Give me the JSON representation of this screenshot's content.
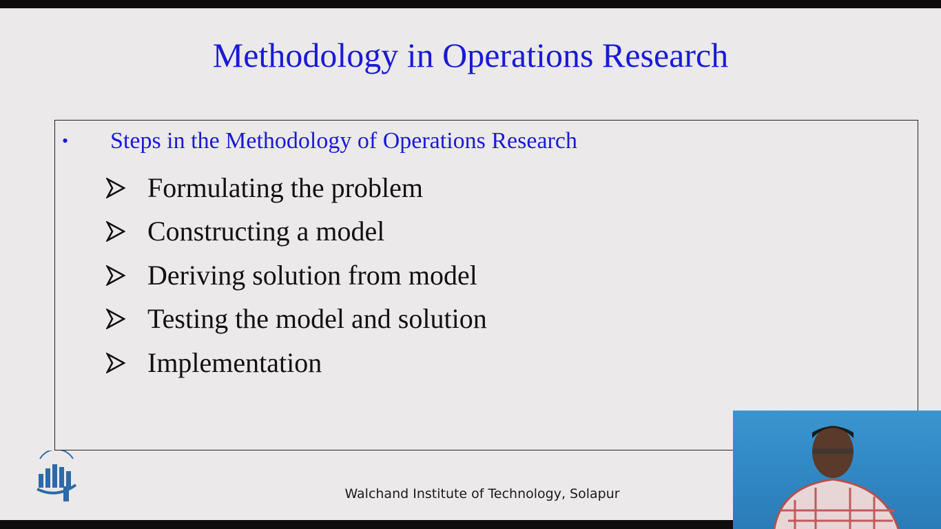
{
  "slide": {
    "title": "Methodology in Operations Research",
    "bullet": "•",
    "section_heading": "Steps in the Methodology of Operations Research",
    "steps": [
      "Formulating the problem",
      "Constructing a model",
      "Deriving solution from model",
      "Testing the model and solution",
      "Implementation"
    ],
    "footer": "Walchand Institute of Technology, Solapur"
  },
  "colors": {
    "title": "#1a1ad6",
    "slide_background": "#ebe9ea",
    "text": "#111111",
    "video_background": "#3a95cf"
  }
}
